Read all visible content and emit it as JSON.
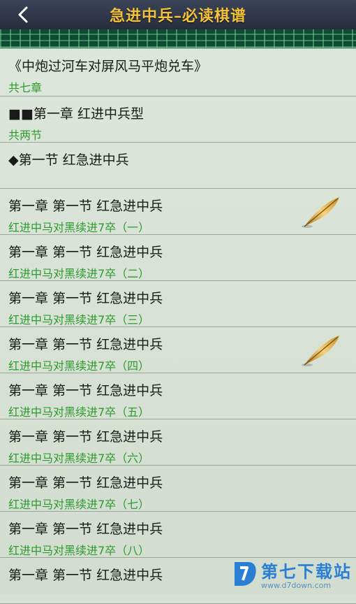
{
  "header": {
    "title": "急进中兵–必读棋谱",
    "back_icon": "chevron-left-icon"
  },
  "items": [
    {
      "title": "《中炮过河车对屏风马平炮兑车》",
      "subtitle": "共七章"
    },
    {
      "title": "■■第一章 红进中兵型",
      "subtitle": "共两节"
    },
    {
      "title": "◆第一节 红急进中兵",
      "subtitle": ""
    },
    {
      "title": "第一章 第一节 红急进中兵",
      "subtitle": "红进中马对黑续进7卒（一）",
      "icon": "feather-icon"
    },
    {
      "title": "第一章 第一节 红急进中兵",
      "subtitle": "红进中马对黑续进7卒（二）"
    },
    {
      "title": "第一章 第一节 红急进中兵",
      "subtitle": "红进中马对黑续进7卒（三）"
    },
    {
      "title": "第一章 第一节 红急进中兵",
      "subtitle": "红进中马对黑续进7卒（四）",
      "icon": "feather-icon"
    },
    {
      "title": "第一章 第一节 红急进中兵",
      "subtitle": "红进中马对黑续进7卒（五）"
    },
    {
      "title": "第一章 第一节 红急进中兵",
      "subtitle": "红进中马对黑续进7卒（六）"
    },
    {
      "title": "第一章 第一节 红急进中兵",
      "subtitle": "红进中马对黑续进7卒（七）"
    },
    {
      "title": "第一章 第一节 红急进中兵",
      "subtitle": "红进中马对黑续进7卒（八）"
    },
    {
      "title": "第一章 第一节 红急进中兵",
      "subtitle": ""
    }
  ],
  "watermark": {
    "name": "第七下载站",
    "url": "www.d7down.com"
  },
  "colors": {
    "header_bg": "#262d3c",
    "title_gold": "#f3c23a",
    "subtitle_green": "#2c9a2c",
    "watermark_blue": "#2a7fd4"
  }
}
